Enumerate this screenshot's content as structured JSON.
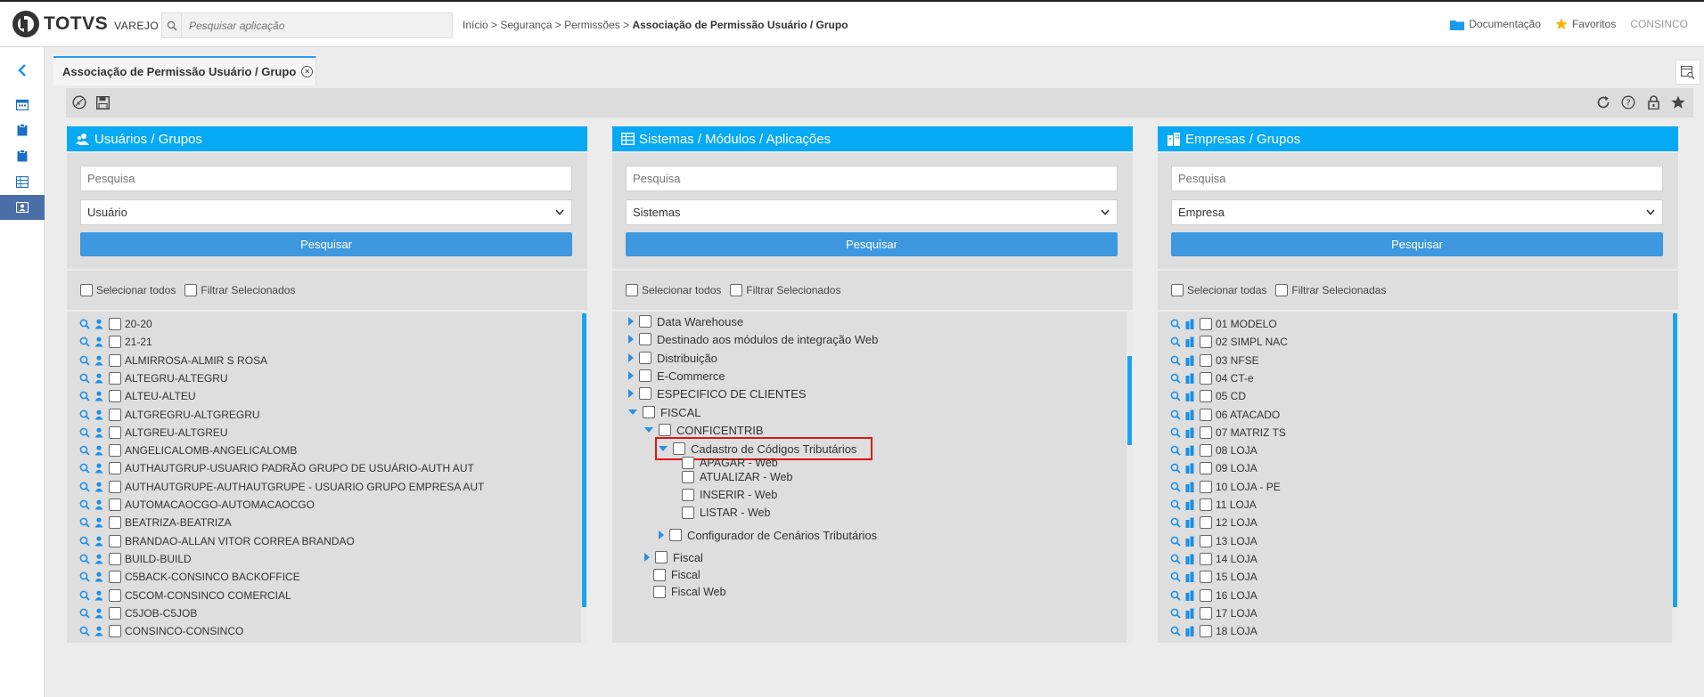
{
  "brand": {
    "name": "TOTVS",
    "sub": "VAREJO"
  },
  "search": {
    "placeholder": "Pesquisar aplicação"
  },
  "breadcrumb": {
    "path": "Início > Segurança > Permissões > ",
    "current": "Associação de Permissão Usuário / Grupo"
  },
  "header_links": {
    "docs": "Documentação",
    "favorites": "Favoritos",
    "user": "CONSINCO"
  },
  "tab": {
    "label": "Associação de Permissão Usuário / Grupo"
  },
  "panels": {
    "users": {
      "title": "Usuários / Grupos",
      "search_placeholder": "Pesquisa",
      "select_value": "Usuário",
      "button": "Pesquisar",
      "select_all": "Selecionar todos",
      "filter_selected": "Filtrar Selecionados",
      "items": [
        "20-20",
        "21-21",
        "ALMIRROSA-ALMIR S ROSA",
        "ALTEGRU-ALTEGRU",
        "ALTEU-ALTEU",
        "ALTGREGRU-ALTGREGRU",
        "ALTGREU-ALTGREU",
        "ANGELICALOMB-ANGELICALOMB",
        "AUTHAUTGRUP-USUARIO PADRÃO GRUPO DE USUÁRIO-AUTH AUT",
        "AUTHAUTGRUPE-AUTHAUTGRUPE - USUARIO GRUPO EMPRESA AUT",
        "AUTOMACAOCGO-AUTOMACAOCGO",
        "BEATRIZA-BEATRIZA",
        "BRANDAO-ALLAN VITOR CORREA BRANDAO",
        "BUILD-BUILD",
        "C5BACK-CONSINCO BACKOFFICE",
        "C5COM-CONSINCO COMERCIAL",
        "C5JOB-C5JOB",
        "CONSINCO-CONSINCO"
      ]
    },
    "systems": {
      "title": "Sistemas / Módulos / Aplicações",
      "search_placeholder": "Pesquisa",
      "select_value": "Sistemas",
      "button": "Pesquisar",
      "select_all": "Selecionar todos",
      "filter_selected": "Filtrar Selecionados",
      "tree": {
        "data_warehouse": "Data Warehouse",
        "destinado": "Destinado aos módulos de integração Web",
        "distribuicao": "Distribuição",
        "ecommerce": "E-Commerce",
        "especifico": "ESPECIFICO DE CLIENTES",
        "fiscal": "FISCAL",
        "conficentrib": "CONFICENTRIB",
        "cadastro": "Cadastro de Códigos Tributários",
        "apagar": "APAGAR - Web",
        "atualizar": "ATUALIZAR - Web",
        "inserir": "INSERIR - Web",
        "listar": "LISTAR - Web",
        "configurador": "Configurador de Cenários Tributários",
        "fiscal2": "Fiscal",
        "fiscal3": "Fiscal",
        "fiscal_web": "Fiscal Web"
      }
    },
    "companies": {
      "title": "Empresas / Grupos",
      "search_placeholder": "Pesquisa",
      "select_value": "Empresa",
      "button": "Pesquisar",
      "select_all": "Selecionar todas",
      "filter_selected": "Filtrar Selecionadas",
      "items": [
        "01 MODELO",
        "02 SIMPL NAC",
        "03 NFSE",
        "04 CT-e",
        "05 CD",
        "06 ATACADO",
        "07 MATRIZ TS",
        "08 LOJA",
        "09 LOJA",
        "10 LOJA - PE",
        "11 LOJA",
        "12 LOJA",
        "13 LOJA",
        "14 LOJA",
        "15 LOJA",
        "16 LOJA",
        "17 LOJA",
        "18 LOJA"
      ]
    }
  },
  "colors": {
    "accent": "#06a9f3",
    "button": "#3d98e0",
    "highlight": "#e01515"
  }
}
